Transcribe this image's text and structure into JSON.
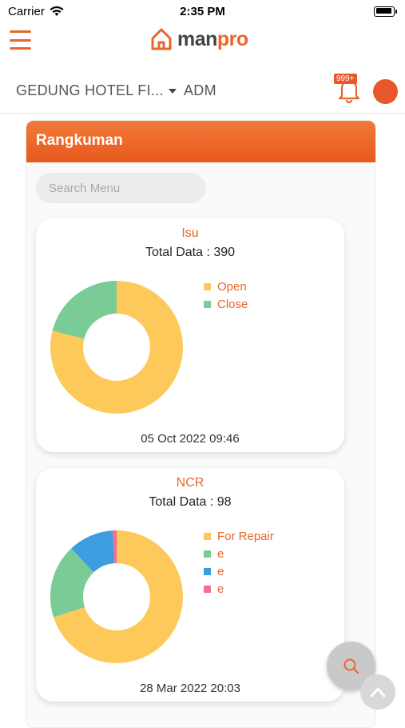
{
  "status_bar": {
    "carrier": "Carrier",
    "time": "2:35 PM"
  },
  "header": {
    "logo_text_main": "man",
    "logo_text_accent": "pro",
    "accent_color": "#e8662a"
  },
  "subheader": {
    "project": "GEDUNG HOTEL FI...",
    "role": "ADM",
    "notification_count": "999+"
  },
  "summary": {
    "title": "Rangkuman",
    "search_placeholder": "Search Menu",
    "cards": [
      {
        "title": "Isu",
        "total": "Total Data : 390",
        "date": "05 Oct 2022 09:46",
        "legend": [
          {
            "label": "Open",
            "color": "#fdc95a"
          },
          {
            "label": "Close",
            "color": "#79cc95"
          }
        ],
        "values": [
          0.79,
          0.21
        ]
      },
      {
        "title": "NCR",
        "total": "Total Data : 98",
        "date": "28 Mar 2022 20:03",
        "legend": [
          {
            "label": "For Repair",
            "color": "#fdc95a"
          },
          {
            "label": "e",
            "color": "#79cc95"
          },
          {
            "label": "e",
            "color": "#3d9de0"
          },
          {
            "label": "e",
            "color": "#f26e96"
          }
        ],
        "values": [
          0.7,
          0.18,
          0.11,
          0.01
        ]
      }
    ]
  }
}
